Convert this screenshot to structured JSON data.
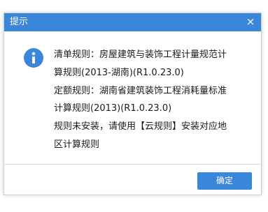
{
  "dialog": {
    "title": "提示",
    "close_glyph": "×",
    "icon": "info-icon",
    "accent_color": "#3a86d9",
    "message_lines": [
      "清单规则：房屋建筑与装饰工程计量规范计",
      "算规则(2013-湖南)(R1.0.23.0)",
      "定额规则：湖南省建筑装饰工程消耗量标准",
      "计算规则(2013)(R1.0.23.0)",
      "规则未安装，请使用【云规则】安装对应地",
      "区计算规则"
    ],
    "ok_label": "确定"
  }
}
